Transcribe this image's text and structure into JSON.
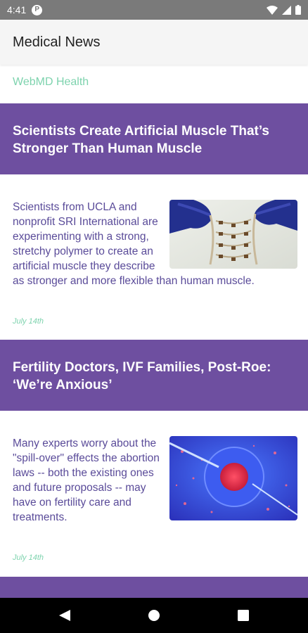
{
  "status_bar": {
    "time": "4:41",
    "app_icon": "pocket-icon",
    "icons": [
      "wifi-icon",
      "signal-icon",
      "battery-icon"
    ]
  },
  "header": {
    "title": "Medical News"
  },
  "source": {
    "label": "WebMD Health"
  },
  "articles": [
    {
      "title": "Scientists Create Artificial Muscle That’s Stronger Than Human Muscle",
      "summary": "Scientists from UCLA and nonprofit SRI International are experimenting with a strong, stretchy polymer to create an artificial muscle they describe as stronger and more flexible than human muscle.",
      "date": "July 14th",
      "thumbnail": "artificial-muscle-photo"
    },
    {
      "title": "Fertility Doctors, IVF Families, Post-Roe: ‘We’re Anxious’",
      "summary": "Many experts worry about the \"spill-over\" effects the abortion laws -- both the existing ones and future proposals -- may have on fertility care and treatments.",
      "date": "July 14th",
      "thumbnail": "ivf-cell-photo"
    }
  ],
  "nav_bar": {
    "back": "back-triangle-icon",
    "home": "home-circle-icon",
    "recents": "recents-square-icon"
  },
  "colors": {
    "header_purple": "#6e4fa0",
    "body_text": "#5a4b99",
    "accent_green": "#7ed3ae",
    "status_gray": "#7a7a7a"
  }
}
